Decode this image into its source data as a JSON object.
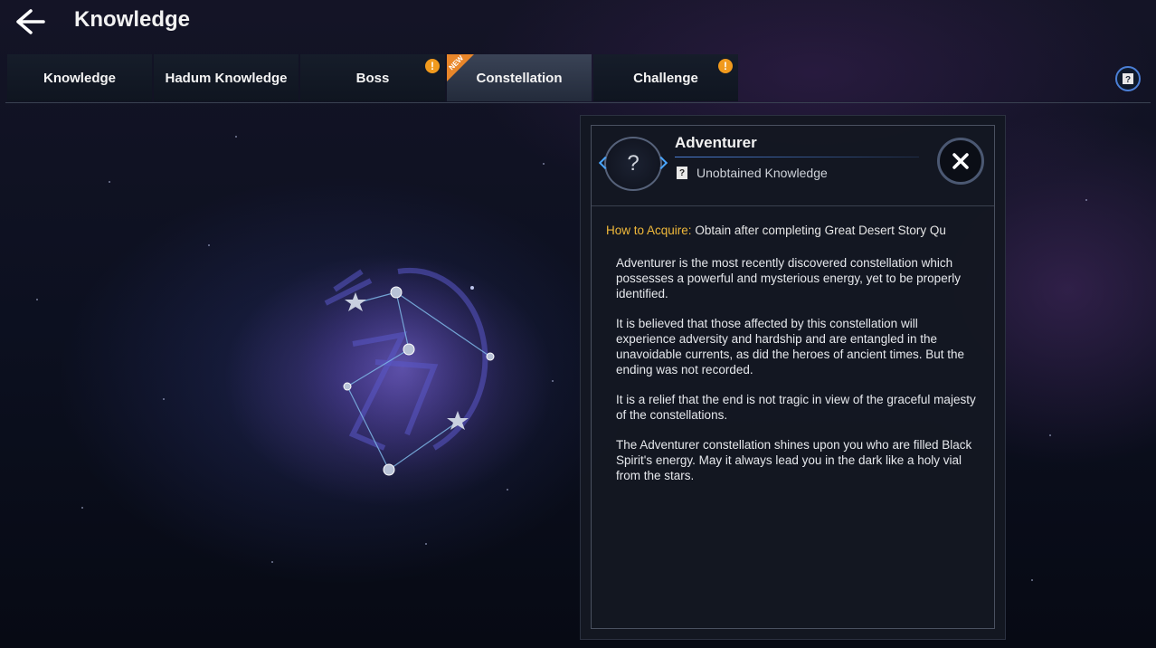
{
  "header": {
    "title": "Knowledge"
  },
  "tabs": [
    {
      "label": "Knowledge",
      "active": false,
      "alert": false
    },
    {
      "label": "Hadum Knowledge",
      "active": false,
      "alert": false
    },
    {
      "label": "Boss",
      "active": false,
      "alert": true
    },
    {
      "label": "Constellation",
      "active": true,
      "alert": false,
      "new": true
    },
    {
      "label": "Challenge",
      "active": false,
      "alert": true
    }
  ],
  "badges": {
    "alert_symbol": "!",
    "new_label": "NEW"
  },
  "detail": {
    "icon_symbol": "?",
    "name": "Adventurer",
    "status": "Unobtained Knowledge",
    "acquire_label": "How to Acquire:",
    "acquire_text": "Obtain after completing Great Desert Story Qu",
    "paragraphs": [
      " Adventurer is the most recently discovered constellation which possesses a powerful and mysterious energy, yet to be properly identified.",
      " It is believed that those affected by this constellation will experience adversity and hardship and are entangled in the unavoidable currents, as did the heroes of ancient times. But the ending was not recorded.",
      " It is a relief that the end is not tragic in view of the graceful majesty of the constellations.",
      " The Adventurer constellation shines upon you who are filled Black Spirit's energy. May it always lead you in the dark like a holy vial from the stars."
    ]
  },
  "colors": {
    "accent_blue": "#4b7fd6",
    "acquire_label": "#f0b93a",
    "alert_orange": "#f19a1d"
  }
}
